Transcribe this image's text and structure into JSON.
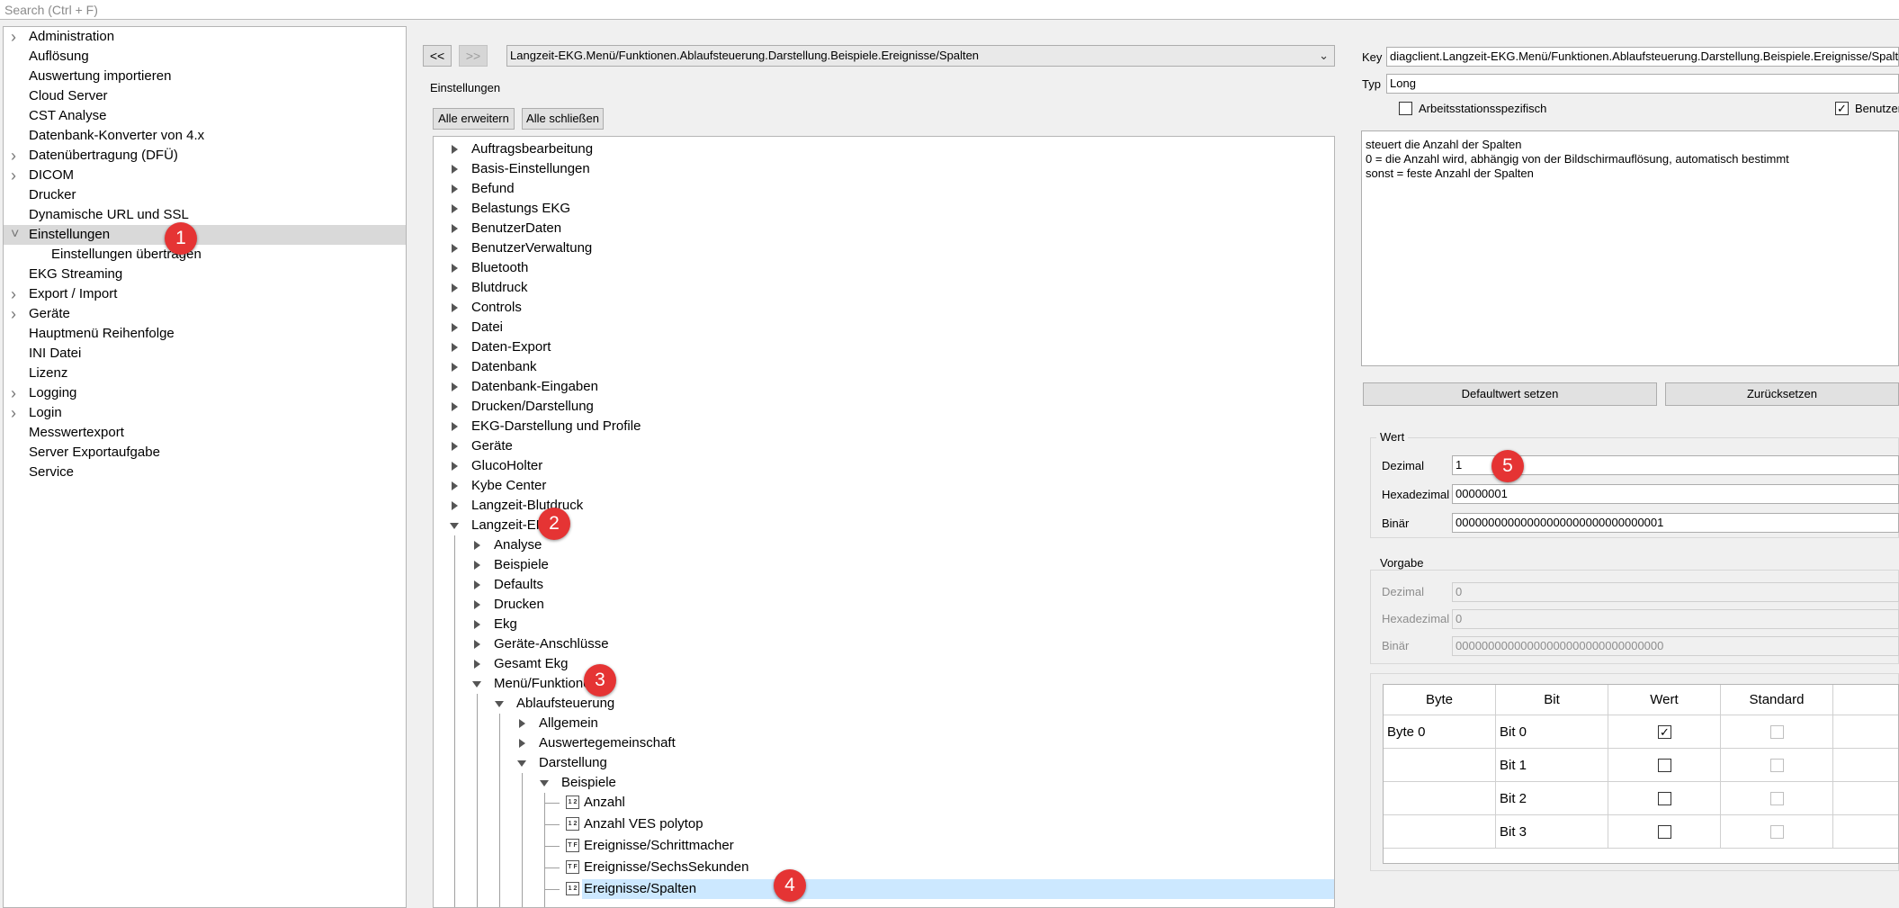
{
  "search": {
    "placeholder": "Search (Ctrl + F)"
  },
  "left_tree": {
    "items": [
      {
        "label": "Administration",
        "expandable": true
      },
      {
        "label": "Auflösung",
        "expandable": false
      },
      {
        "label": "Auswertung importieren",
        "expandable": false
      },
      {
        "label": "Cloud Server",
        "expandable": false
      },
      {
        "label": "CST Analyse",
        "expandable": false
      },
      {
        "label": "Datenbank-Konverter von 4.x",
        "expandable": false
      },
      {
        "label": "Datenübertragung (DFÜ)",
        "expandable": true
      },
      {
        "label": "DICOM",
        "expandable": true
      },
      {
        "label": "Drucker",
        "expandable": false
      },
      {
        "label": "Dynamische URL und SSL",
        "expandable": false
      },
      {
        "label": "Einstellungen",
        "expandable": true,
        "expanded": true,
        "selected": true
      },
      {
        "label": "Einstellungen übertragen",
        "expandable": false,
        "sub": true
      },
      {
        "label": "EKG Streaming",
        "expandable": false
      },
      {
        "label": "Export / Import",
        "expandable": true
      },
      {
        "label": "Geräte",
        "expandable": true
      },
      {
        "label": "Hauptmenü Reihenfolge",
        "expandable": false
      },
      {
        "label": "INI Datei",
        "expandable": false
      },
      {
        "label": "Lizenz",
        "expandable": false
      },
      {
        "label": "Logging",
        "expandable": true
      },
      {
        "label": "Login",
        "expandable": true
      },
      {
        "label": "Messwertexport",
        "expandable": false
      },
      {
        "label": "Server Exportaufgabe",
        "expandable": false
      },
      {
        "label": "Service",
        "expandable": false
      }
    ]
  },
  "badges": [
    "1",
    "2",
    "3",
    "4",
    "5"
  ],
  "nav": {
    "back_label": "<<",
    "forward_label": ">>"
  },
  "path_combo": {
    "value": "Langzeit-EKG.Menü/Funktionen.Ablaufsteuerung.Darstellung.Beispiele.Ereignisse/Spalten"
  },
  "settings": {
    "title": "Einstellungen",
    "expand_all_label": "Alle erweitern",
    "collapse_all_label": "Alle schließen"
  },
  "mid_tree": {
    "items": [
      {
        "label": "Auftragsbearbeitung",
        "level": 0,
        "kind": "closed"
      },
      {
        "label": "Basis-Einstellungen",
        "level": 0,
        "kind": "closed"
      },
      {
        "label": "Befund",
        "level": 0,
        "kind": "closed"
      },
      {
        "label": "Belastungs EKG",
        "level": 0,
        "kind": "closed"
      },
      {
        "label": "BenutzerDaten",
        "level": 0,
        "kind": "closed"
      },
      {
        "label": "BenutzerVerwaltung",
        "level": 0,
        "kind": "closed"
      },
      {
        "label": "Bluetooth",
        "level": 0,
        "kind": "closed"
      },
      {
        "label": "Blutdruck",
        "level": 0,
        "kind": "closed"
      },
      {
        "label": "Controls",
        "level": 0,
        "kind": "closed"
      },
      {
        "label": "Datei",
        "level": 0,
        "kind": "closed"
      },
      {
        "label": "Daten-Export",
        "level": 0,
        "kind": "closed"
      },
      {
        "label": "Datenbank",
        "level": 0,
        "kind": "closed"
      },
      {
        "label": "Datenbank-Eingaben",
        "level": 0,
        "kind": "closed"
      },
      {
        "label": "Drucken/Darstellung",
        "level": 0,
        "kind": "closed"
      },
      {
        "label": "EKG-Darstellung und Profile",
        "level": 0,
        "kind": "closed"
      },
      {
        "label": "Geräte",
        "level": 0,
        "kind": "closed"
      },
      {
        "label": "GlucoHolter",
        "level": 0,
        "kind": "closed"
      },
      {
        "label": "Kybe Center",
        "level": 0,
        "kind": "closed"
      },
      {
        "label": "Langzeit-Blutdruck",
        "level": 0,
        "kind": "closed"
      },
      {
        "label": "Langzeit-EKG",
        "level": 0,
        "kind": "open"
      },
      {
        "label": "Analyse",
        "level": 1,
        "kind": "closed"
      },
      {
        "label": "Beispiele",
        "level": 1,
        "kind": "closed"
      },
      {
        "label": "Defaults",
        "level": 1,
        "kind": "closed"
      },
      {
        "label": "Drucken",
        "level": 1,
        "kind": "closed"
      },
      {
        "label": "Ekg",
        "level": 1,
        "kind": "closed"
      },
      {
        "label": "Geräte-Anschlüsse",
        "level": 1,
        "kind": "closed"
      },
      {
        "label": "Gesamt Ekg",
        "level": 1,
        "kind": "closed"
      },
      {
        "label": "Menü/Funktionen",
        "level": 1,
        "kind": "open"
      },
      {
        "label": "Ablaufsteuerung",
        "level": 2,
        "kind": "open"
      },
      {
        "label": "Allgemein",
        "level": 3,
        "kind": "closed"
      },
      {
        "label": "Auswertegemeinschaft",
        "level": 3,
        "kind": "closed"
      },
      {
        "label": "Darstellung",
        "level": 3,
        "kind": "open"
      },
      {
        "label": "Beispiele",
        "level": 4,
        "kind": "open"
      },
      {
        "label": "Anzahl",
        "level": 5,
        "kind": "leaf",
        "icon": "12"
      },
      {
        "label": "Anzahl VES polytop",
        "level": 5,
        "kind": "leaf",
        "icon": "12"
      },
      {
        "label": "Ereignisse/Schrittmacher",
        "level": 5,
        "kind": "leaf",
        "icon": "TF"
      },
      {
        "label": "Ereignisse/SechsSekunden",
        "level": 5,
        "kind": "leaf",
        "icon": "TF"
      },
      {
        "label": "Ereignisse/Spalten",
        "level": 5,
        "kind": "leaf",
        "icon": "12",
        "selected": true
      }
    ]
  },
  "detail": {
    "key_label": "Key",
    "key_value": "diagclient.Langzeit-EKG.Menü/Funktionen.Ablaufsteuerung.Darstellung.Beispiele.Ereignisse/Spalten",
    "type_label": "Typ",
    "type_value": "Long",
    "workstation_label": "Arbeitsstationsspezifisch",
    "workstation_checked": false,
    "user_label": "Benutzer",
    "user_checked": true,
    "description": [
      "steuert die Anzahl der Spalten",
      "0 = die Anzahl wird, abhängig von der Bildschirmauflösung, automatisch bestimmt",
      "sonst = feste Anzahl der Spalten"
    ],
    "default_button": "Defaultwert setzen",
    "reset_button": "Zurücksetzen"
  },
  "value_group": {
    "title": "Wert",
    "decimal_label": "Dezimal",
    "decimal_value": "1",
    "hex_label": "Hexadezimal",
    "hex_value": "00000001",
    "bin_label": "Binär",
    "bin_value": "00000000000000000000000000000001"
  },
  "default_group": {
    "title": "Vorgabe",
    "decimal_label": "Dezimal",
    "decimal_value": "0",
    "hex_label": "Hexadezimal",
    "hex_value": "0",
    "bin_label": "Binär",
    "bin_value": "00000000000000000000000000000000"
  },
  "bit_table": {
    "headers": [
      "Byte",
      "Bit",
      "Wert",
      "Standard"
    ],
    "rows": [
      {
        "byte": "Byte 0",
        "bit": "Bit 0",
        "wert": true,
        "standard": false
      },
      {
        "byte": "",
        "bit": "Bit 1",
        "wert": false,
        "standard": false
      },
      {
        "byte": "",
        "bit": "Bit 2",
        "wert": false,
        "standard": false
      },
      {
        "byte": "",
        "bit": "Bit 3",
        "wert": false,
        "standard": false
      }
    ]
  }
}
